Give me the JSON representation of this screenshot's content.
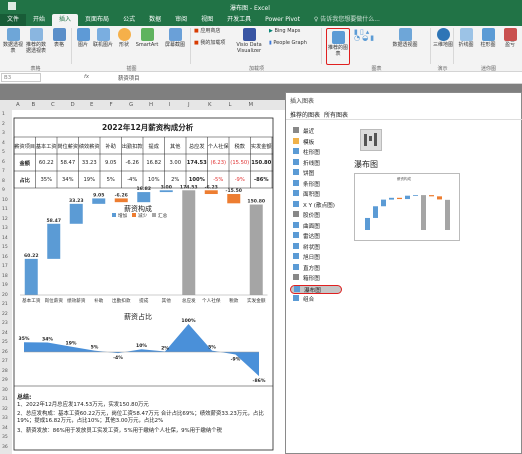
{
  "app": {
    "title": "瀑布图 - Excel",
    "search_hint": "告诉我您想要做什么..."
  },
  "tabs": [
    "文件",
    "开始",
    "插入",
    "页面布局",
    "公式",
    "数据",
    "审阅",
    "视图",
    "开发工具",
    "Power Pivot"
  ],
  "ribbon": {
    "tables": {
      "pivot": "数据透视表",
      "recommended_pivot": "推荐的数据透视表",
      "table": "表格",
      "group": "表格"
    },
    "illustrations": {
      "pictures": "图片",
      "online_pictures": "联机图片",
      "shapes": "形状",
      "smartart": "SmartArt",
      "screenshot": "屏幕截图",
      "group": "插图"
    },
    "addins": {
      "store": "应用商店",
      "my_addins": "我的加载项",
      "visio": "Visio Data Visualizer",
      "bing": "Bing Maps",
      "people": "People Graph",
      "group": "加载项"
    },
    "charts": {
      "recommended": "推荐的图表",
      "pivotchart": "数据透视图",
      "group": "图表",
      "three_d": "三维地图",
      "tours_group": "演示"
    },
    "sparklines": {
      "line": "折线图",
      "column": "柱形图",
      "winloss": "盈亏",
      "group": "迷你图"
    }
  },
  "formula_bar": {
    "name_box": "B3",
    "fx": "fx",
    "content": "薪资项目"
  },
  "columns": [
    "A",
    "B",
    "C",
    "D",
    "E",
    "F",
    "G",
    "H",
    "I",
    "J",
    "K",
    "L",
    "M"
  ],
  "rows": [
    "1",
    "2",
    "3",
    "4",
    "5",
    "6",
    "7",
    "8",
    "9",
    "10",
    "11",
    "12",
    "13",
    "14",
    "15",
    "16",
    "17",
    "18",
    "19",
    "20",
    "21",
    "22",
    "23",
    "24",
    "25",
    "26",
    "27",
    "28",
    "29",
    "30",
    "31",
    "32",
    "33",
    "34",
    "35",
    "36"
  ],
  "report": {
    "title": "2022年12月薪资构成分析",
    "headers": [
      "薪资项目",
      "基本工资",
      "岗位薪资",
      "绩效薪资",
      "补助",
      "出勤扣款",
      "提成",
      "其他",
      "总应发",
      "个人社保",
      "税款",
      "实发金额"
    ],
    "amount_label": "金额",
    "amounts": [
      "60.22",
      "58.47",
      "33.23",
      "9.05",
      "-6.26",
      "16.82",
      "3.00",
      "174.53",
      "(6.23)",
      "(15.50)",
      "150.80"
    ],
    "ratio_label": "占比",
    "ratios": [
      "35%",
      "34%",
      "19%",
      "5%",
      "-4%",
      "10%",
      "2%",
      "100%",
      "-5%",
      "-9%",
      "-86%"
    ]
  },
  "chart_data": [
    {
      "type": "waterfall",
      "title": "薪资构成",
      "legend": [
        "增加",
        "减少",
        "汇总"
      ],
      "categories": [
        "基本工资",
        "岗位薪资",
        "绩效薪资",
        "补助",
        "出勤扣款",
        "提成",
        "其他",
        "总应发",
        "个人社保",
        "税款",
        "实发金额"
      ],
      "values": [
        60.22,
        58.47,
        33.23,
        9.05,
        -6.26,
        16.82,
        3.0,
        174.53,
        -6.23,
        -15.5,
        150.8
      ],
      "labels": [
        "60.22",
        "58.47",
        "33.23",
        "9.05",
        "-6.26",
        "16.82",
        "3.00",
        "174.53",
        "-6.23",
        "-15.50",
        "150.80"
      ],
      "kinds": [
        "increase",
        "increase",
        "increase",
        "increase",
        "decrease",
        "increase",
        "increase",
        "total",
        "decrease",
        "decrease",
        "total"
      ],
      "colors": {
        "increase": "#5b9bd5",
        "decrease": "#ed7d31",
        "total": "#a5a5a5"
      }
    },
    {
      "type": "area",
      "title": "薪资占比",
      "categories": [
        "基本工资",
        "岗位薪资",
        "绩效薪资",
        "补助",
        "出勤扣款",
        "提成",
        "其他",
        "总应发",
        "个人社保",
        "税款",
        "实发金额"
      ],
      "values": [
        35,
        34,
        19,
        5,
        -4,
        10,
        2,
        100,
        5,
        -9,
        -86
      ],
      "labels": [
        "35%",
        "34%",
        "19%",
        "5%",
        "-4%",
        "10%",
        "2%",
        "100%",
        "5%",
        "-9%",
        "-86%"
      ],
      "color": "#4a90d9"
    }
  ],
  "summary": {
    "title": "总结:",
    "lines": [
      "1、2022年12月总应发174.53万元，实发150.80万元",
      "2、总应发构成：基本工资60.22万元，岗位工资58.47万元 合计占比69%；绩效薪资33.23万元，占比19%；提成16.82万元，占比10%；其他3.00万元，占比2%",
      "3、薪资发放：86%用于发放员工实发工资，5%用于缴纳个人社保，9%用于缴纳个税"
    ]
  },
  "dialog": {
    "title": "插入图表",
    "tabs": [
      "推荐的图表",
      "所有图表"
    ],
    "types": [
      "最近",
      "模板",
      "柱形图",
      "折线图",
      "饼图",
      "条形图",
      "面积图",
      "X Y (散点图)",
      "股价图",
      "曲面图",
      "雷达图",
      "树状图",
      "旭日图",
      "直方图",
      "箱形图",
      "瀑布图",
      "组合"
    ],
    "selected": "瀑布图",
    "preview_title": "瀑布图",
    "thumb_title": "薪资构成"
  }
}
